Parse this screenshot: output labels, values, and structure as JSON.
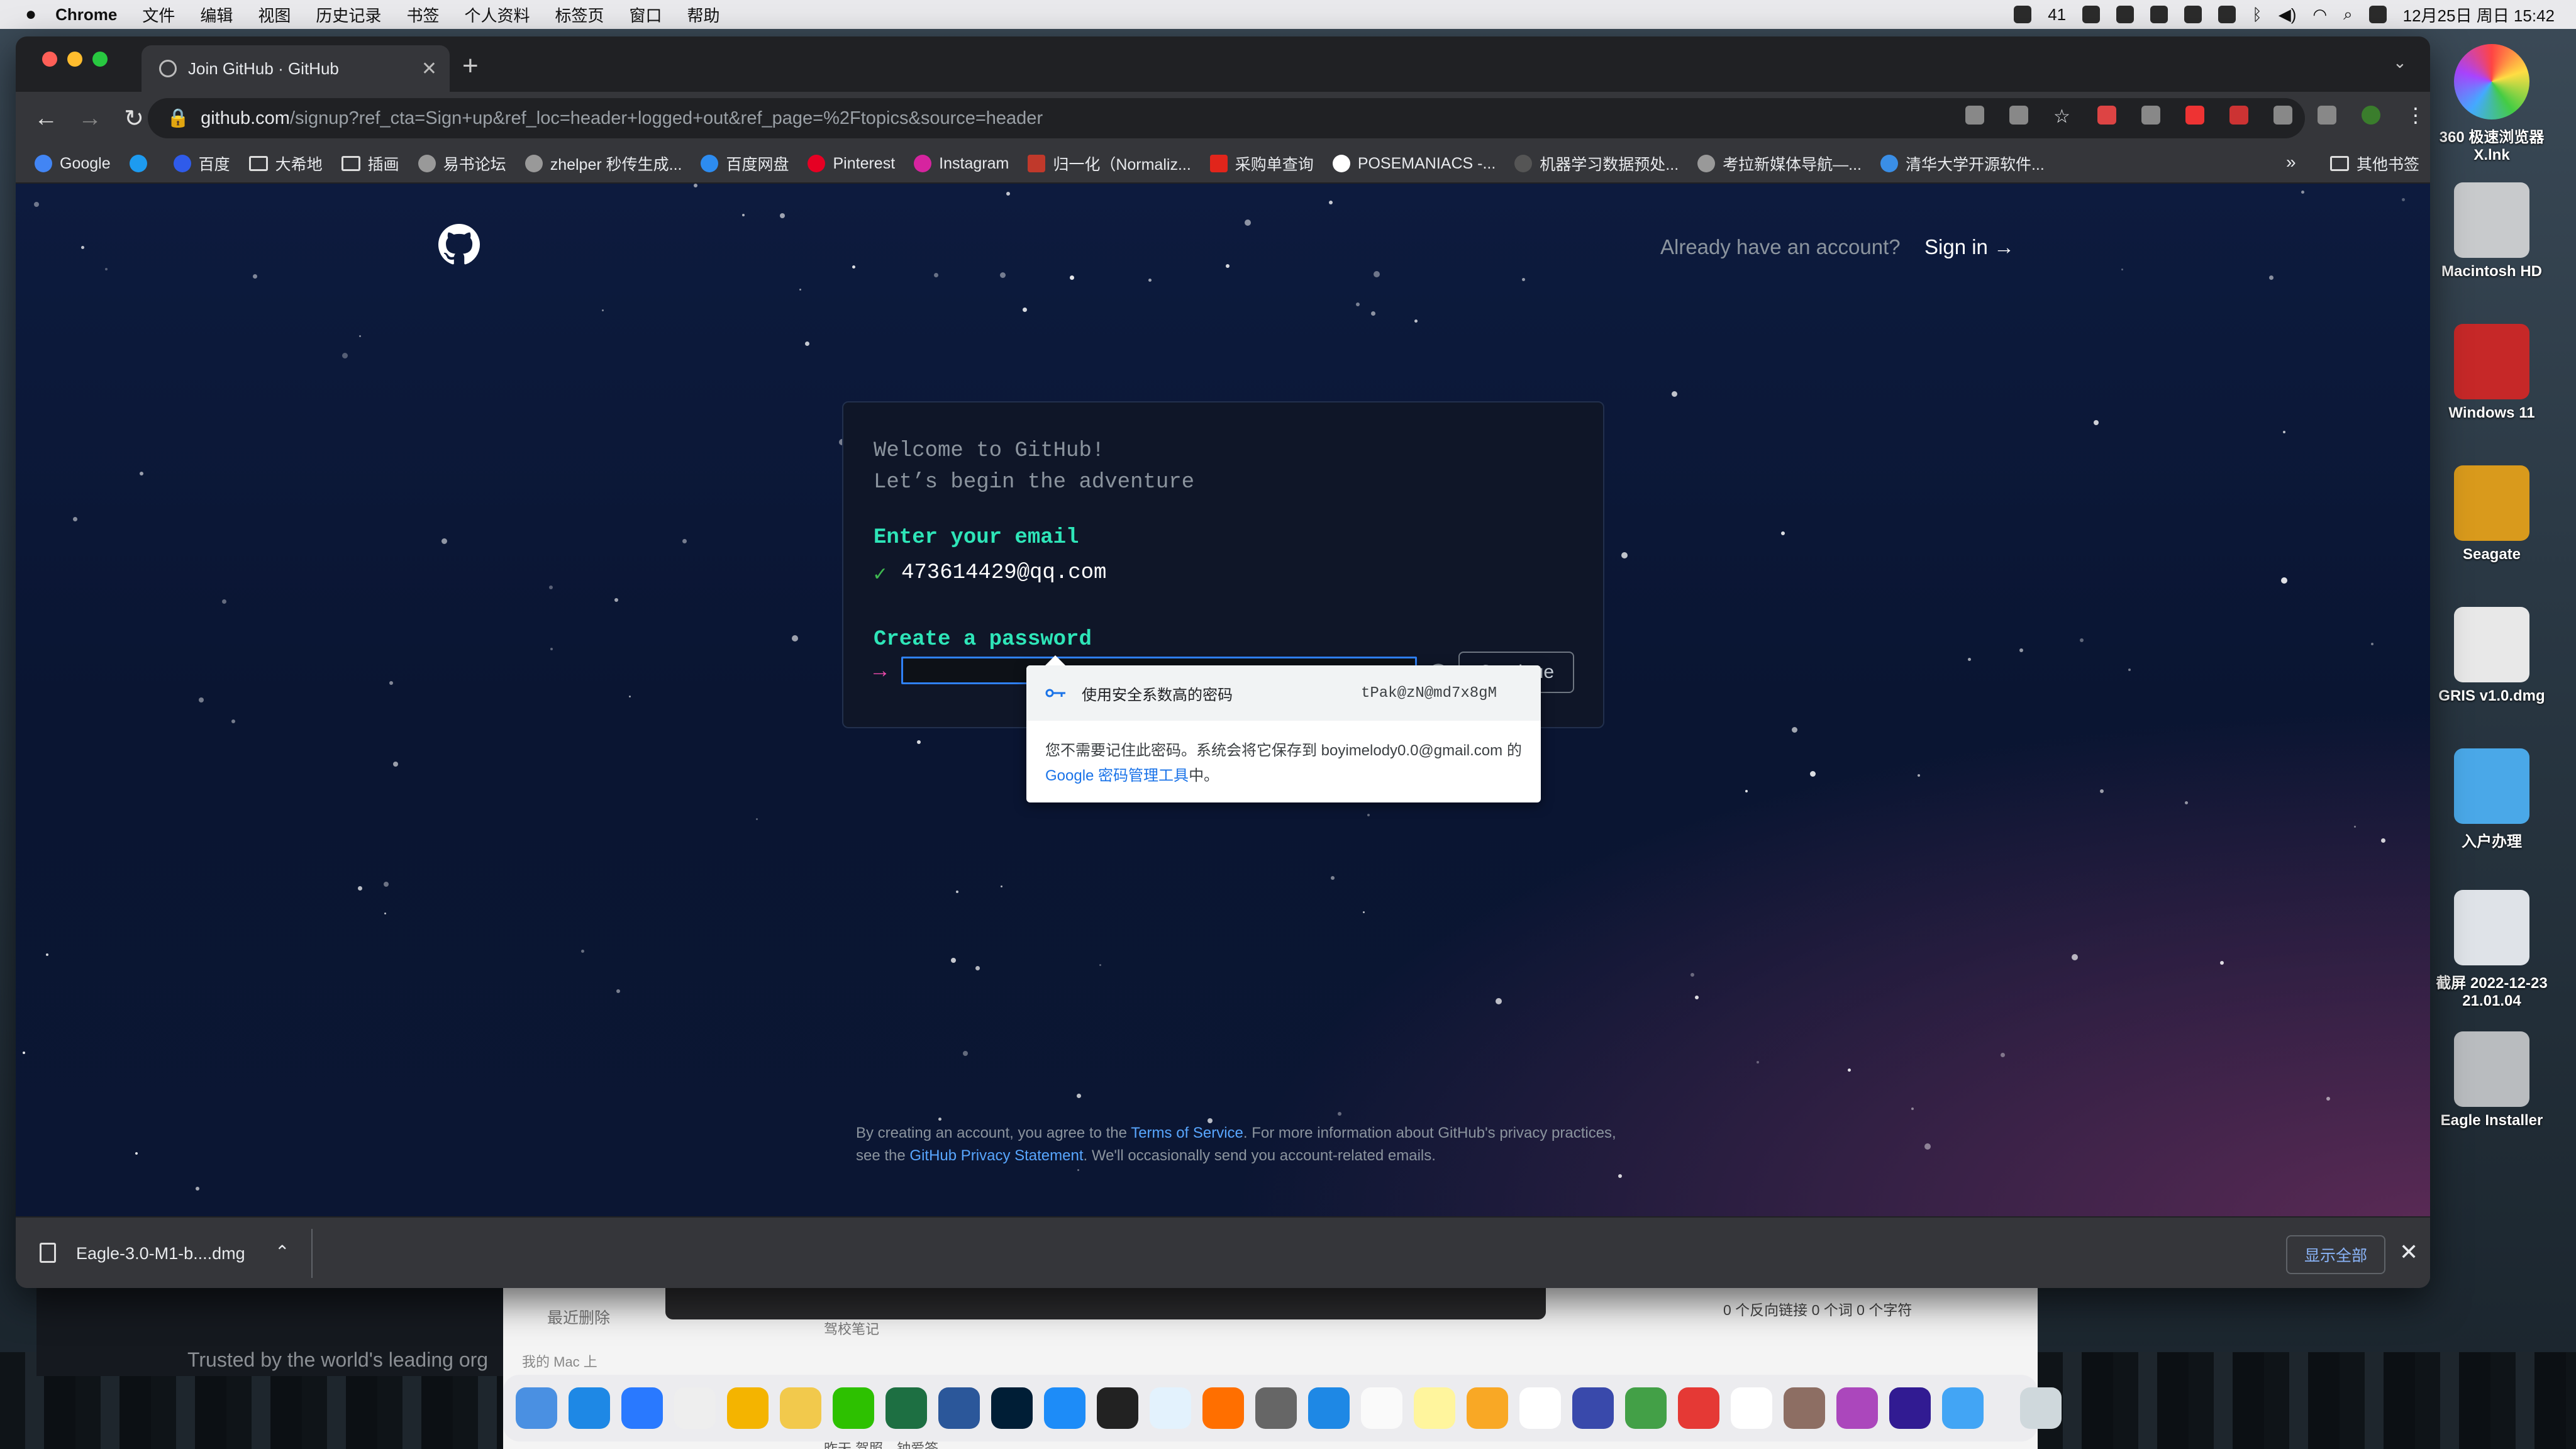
{
  "menubar": {
    "app": "Chrome",
    "items": [
      "文件",
      "编辑",
      "视图",
      "历史记录",
      "书签",
      "个人资料",
      "标签页",
      "窗口",
      "帮助"
    ],
    "status_badge": "41",
    "datetime": "12月25日 周日  15:42"
  },
  "browser": {
    "tab_title": "Join GitHub · GitHub",
    "url_host": "github.com",
    "url_path": "/signup?ref_cta=Sign+up&ref_loc=header+logged+out&ref_page=%2Ftopics&source=header",
    "bookmarks": [
      "Google",
      "",
      "百度",
      "大希地",
      "插画",
      "易书论坛",
      "zhelper 秒传生成...",
      "百度网盘",
      "Pinterest",
      "Instagram",
      "归一化（Normaliz...",
      "采购单查询",
      "POSEMANIACS -...",
      "机器学习数据预处...",
      "考拉新媒体导航—...",
      "清华大学开源软件..."
    ],
    "bookmarks_more": "»",
    "bookmarks_other": "其他书签"
  },
  "page": {
    "already": "Already have an account?",
    "signin": "Sign in →",
    "welcome_line1": "Welcome to GitHub!",
    "welcome_line2": "Let’s begin the adventure",
    "email_label": "Enter your email",
    "email_check": "✓",
    "email_value": "473614429@qq.com",
    "password_label": "Create a password",
    "password_arrow": "→",
    "password_value": "",
    "continue": "Continue",
    "terms_before": "By creating an account, you agree to the ",
    "terms_link1": "Terms of Service",
    "terms_mid": ". For more information about GitHub's privacy practices, see the ",
    "terms_link2": "GitHub Privacy Statement",
    "terms_after": ". We'll occasionally send you account-related emails."
  },
  "password_popup": {
    "title": "使用安全系数高的密码",
    "suggested": "tPak@zN@md7x8gM",
    "desc_before": "您不需要记住此密码。系统会将它保存到 boyimelody0.0@gmail.com 的 ",
    "desc_link": "Google 密码管理工具",
    "desc_after": "中。"
  },
  "download_shelf": {
    "file": "Eagle-3.0-M1-b....dmg",
    "show_all": "显示全部"
  },
  "background": {
    "trusted": "Trusted by the world's leading org",
    "recent_deleted": "最近删除",
    "my_mac": "我的 Mac 上",
    "notes_item": "驾校笔记",
    "links_status": "0 个反向链接   0 个词   0 个字符",
    "bottom_text": "昨天   驾照…钟爱签"
  },
  "desktop_icons": [
    "360 极速浏览器X.lnk",
    "Macintosh HD",
    "Windows 11",
    "Seagate",
    "GRIS v1.0.dmg",
    "入户办理",
    "截屏 2022-12-23 21.01.04",
    "Eagle Installer"
  ],
  "colors": {
    "accent_green": "#2ee5b8",
    "accent_pink": "#ea4aaa",
    "link_blue": "#58a6ff",
    "focus_blue": "#2f81f7"
  }
}
